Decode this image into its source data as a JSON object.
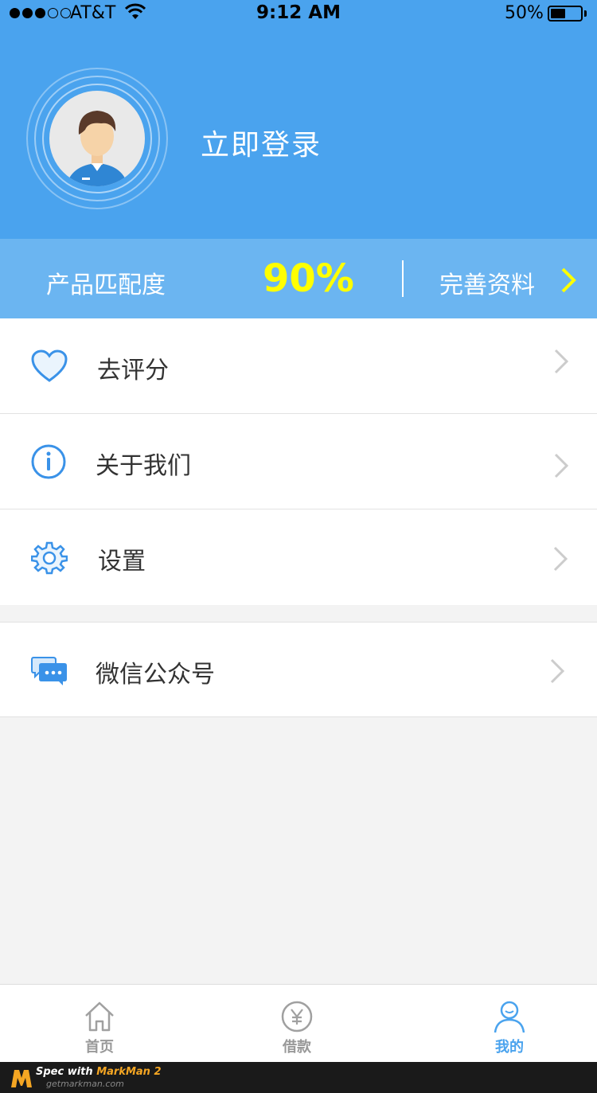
{
  "status_bar": {
    "carrier": "AT&T",
    "time": "9:12 AM",
    "battery_percent": "50%",
    "battery_level": 0.5
  },
  "header": {
    "login_text": "立即登录",
    "avatar_icon": "user-avatar-icon"
  },
  "match": {
    "label": "产品匹配度",
    "value": "90%",
    "action_label": "完善资料",
    "value_color": "#ffff00"
  },
  "menu": {
    "items": [
      {
        "label": "去评分",
        "icon": "heart-icon"
      },
      {
        "label": "关于我们",
        "icon": "info-icon"
      },
      {
        "label": "设置",
        "icon": "gear-icon"
      },
      {
        "label": "微信公众号",
        "icon": "chat-bubble-icon"
      }
    ]
  },
  "tabs": [
    {
      "label": "首页",
      "icon": "home-icon",
      "active": false
    },
    {
      "label": "借款",
      "icon": "yen-icon",
      "active": false
    },
    {
      "label": "我的",
      "icon": "user-icon",
      "active": true
    }
  ],
  "footer": {
    "spec_text": "Spec with ",
    "brand_text": "MarkMan 2",
    "url_text": "getmarkman.com"
  },
  "colors": {
    "header_bg": "#4aa3ee",
    "match_bar_bg": "#6bb5f1",
    "accent": "#4aa3ee",
    "text_main": "#333333",
    "page_bg": "#f3f3f3"
  }
}
